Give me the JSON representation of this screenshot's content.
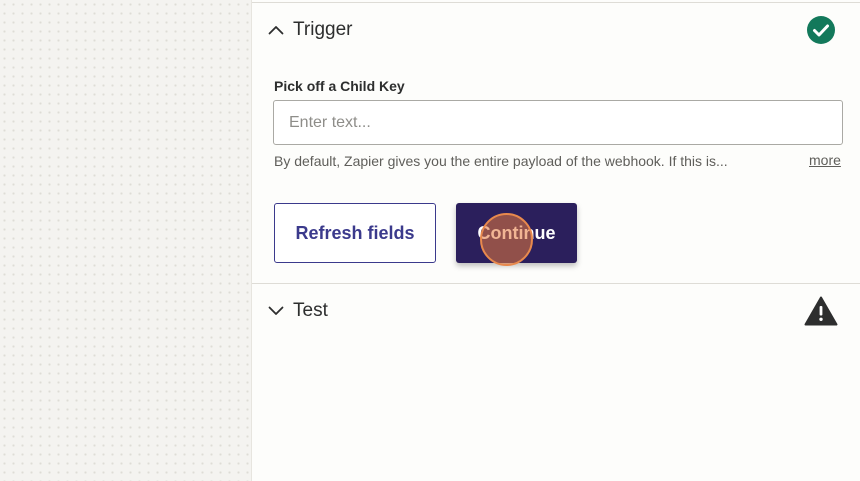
{
  "trigger_section": {
    "title": "Trigger",
    "status_icon": "check-circle-icon",
    "status_color": "#13795b",
    "expanded": true
  },
  "child_key_field": {
    "label": "Pick off a Child Key",
    "value": "",
    "placeholder": "Enter text...",
    "helper_text": "By default, Zapier gives you the entire payload of the webhook. If this is...",
    "more_link": "more"
  },
  "buttons": {
    "refresh_label": "Refresh fields",
    "continue_label": "Continue"
  },
  "test_section": {
    "title": "Test",
    "status_icon": "warning-icon",
    "status_color": "#2d2e2e",
    "expanded": false
  },
  "colors": {
    "primary": "#2b1f5c",
    "accent_link": "#3b3a8c",
    "success": "#13795b"
  }
}
